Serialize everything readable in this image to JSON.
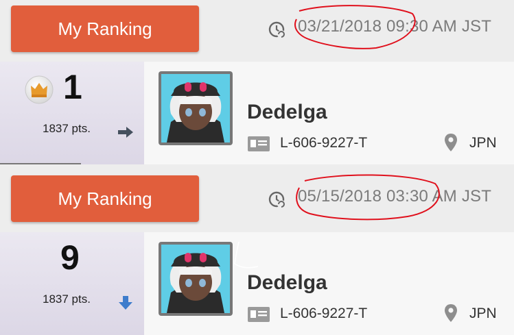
{
  "entries": [
    {
      "button_label": "My Ranking",
      "timestamp": "03/21/2018 09:30 AM JST",
      "rank": "1",
      "points": "1837 pts.",
      "trend_icon": "arrow-right-icon",
      "has_crown": true,
      "player": {
        "name": "Dedelga",
        "id": "L-606-9227-T",
        "country": "JPN"
      }
    },
    {
      "button_label": "My Ranking",
      "timestamp": "05/15/2018 03:30 AM JST",
      "rank": "9",
      "points": "1837 pts.",
      "trend_icon": "arrow-down-icon",
      "has_crown": false,
      "player": {
        "name": "Dedelga",
        "id": "L-606-9227-T",
        "country": "JPN"
      }
    }
  ],
  "colors": {
    "button": "#e15e3c",
    "rank_panel": "#e4e0ec",
    "annotation": "#e0101c",
    "trend_right": "#45505e",
    "trend_down": "#3e7ccc"
  }
}
